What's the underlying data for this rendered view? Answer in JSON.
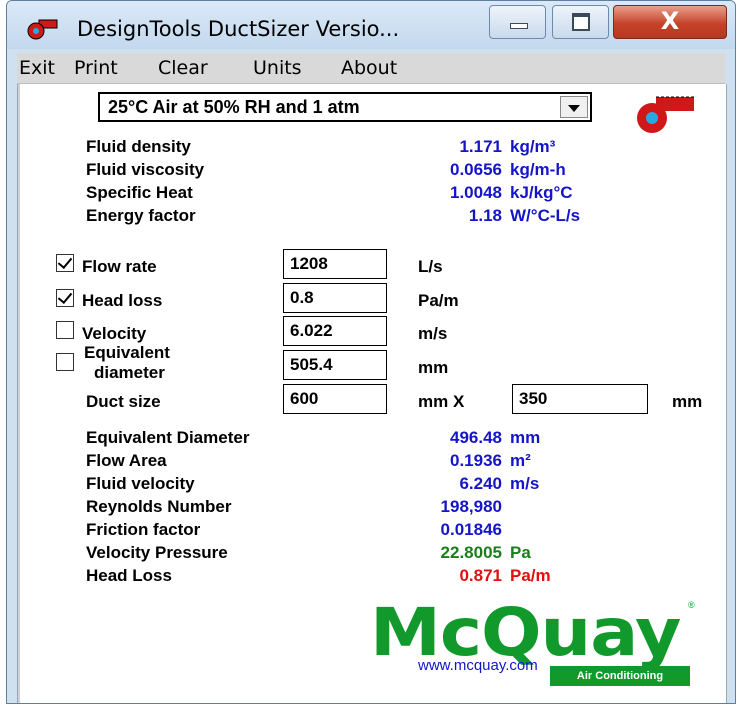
{
  "window": {
    "title": "DesignTools DuctSizer Versio...",
    "close_symbol": "X"
  },
  "menu": [
    "Exit",
    "Print",
    "Clear",
    "Units",
    "About"
  ],
  "fluid_selector": {
    "value": "25°C Air at 50% RH and 1 atm"
  },
  "fluid_props": [
    {
      "label": "Fluid density",
      "value": "1.171",
      "unit": "kg/m³"
    },
    {
      "label": "Fluid viscosity",
      "value": "0.0656",
      "unit": "kg/m-h"
    },
    {
      "label": "Specific Heat",
      "value": "1.0048",
      "unit": "kJ/kg°C"
    },
    {
      "label": "Energy factor",
      "value": "1.18",
      "unit": "W/°C-L/s"
    }
  ],
  "inputs": {
    "flow_rate": {
      "label": "Flow rate",
      "checked": true,
      "value": "1208",
      "unit": "L/s"
    },
    "head_loss": {
      "label": "Head loss",
      "checked": true,
      "value": "0.8",
      "unit": "Pa/m"
    },
    "velocity": {
      "label": "Velocity",
      "checked": false,
      "value": "6.022",
      "unit": "m/s"
    },
    "equivalent_diameter": {
      "label_line1": "Equivalent",
      "label_line2": "diameter",
      "checked": false,
      "value": "505.4",
      "unit": "mm"
    },
    "duct_size": {
      "label": "Duct size",
      "width": "600",
      "unit1": "mm X",
      "height": "350",
      "unit2": "mm"
    }
  },
  "results": [
    {
      "label": "Equivalent Diameter",
      "value": "496.48",
      "unit": "mm",
      "color": "#1515c8"
    },
    {
      "label": "Flow Area",
      "value": "0.1936",
      "unit": "m²",
      "color": "#1515c8"
    },
    {
      "label": "Fluid velocity",
      "value": "6.240",
      "unit": "m/s",
      "color": "#1515c8"
    },
    {
      "label": "Reynolds Number",
      "value": "198,980",
      "unit": "",
      "color": "#1515c8"
    },
    {
      "label": "Friction factor",
      "value": "0.01846",
      "unit": "",
      "color": "#1515c8"
    },
    {
      "label": "Velocity Pressure",
      "value": "22.8005",
      "unit": "Pa",
      "color": "#1a7f1a"
    },
    {
      "label": "Head Loss",
      "value": "0.871",
      "unit": "Pa/m",
      "color": "#e01010"
    }
  ],
  "branding": {
    "logo_text": "McQuay",
    "logo_sub": "Air Conditioning",
    "registered": "®",
    "url": "www.mcquay.com",
    "brand_color": "#119a2b"
  },
  "icons": {
    "app": "fan-duct-icon",
    "panel": "fan-duct-icon"
  }
}
